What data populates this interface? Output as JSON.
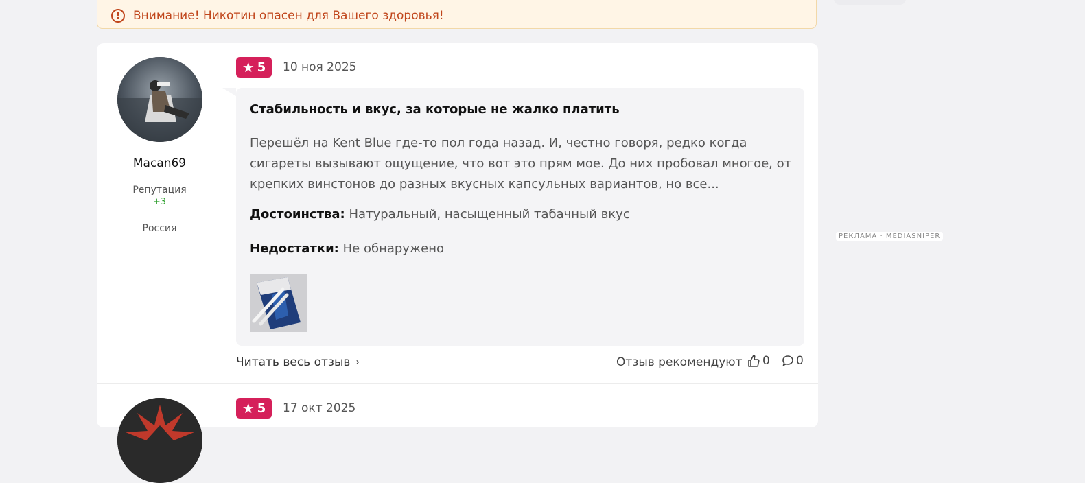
{
  "warning": {
    "text": "Внимание! Никотин опасен для Вашего здоровья!",
    "icon": "alert-circle-icon"
  },
  "ad": {
    "label": "РЕКЛАМА · MEDIASNIPER"
  },
  "reviews": [
    {
      "author": "Macan69",
      "reputation_label": "Репутация",
      "reputation_value": "+3",
      "country": "Россия",
      "rating": "5",
      "date": "10 ноя 2025",
      "title": "Стабильность и вкус, за которые не жалко платить",
      "text": "Перешёл на Kent Blue где-то пол года назад. И, честно говоря, редко когда сигареты вызывают ощущение, что вот это прям мое. До них пробовал многое, от крепких винстонов до разных вкусных капсульных вариантов, но все...",
      "pros_label": "Достоинства:",
      "pros": "Натуральный, насыщенный табачный вкус",
      "cons_label": "Недостатки:",
      "cons": "Не обнаружено",
      "read_more": "Читать весь отзыв",
      "recommend_label": "Отзыв рекомендуют",
      "likes": "0",
      "comments": "0"
    },
    {
      "rating": "5",
      "date": "17 окт 2025"
    }
  ],
  "colors": {
    "accent": "#d5205a",
    "warning": "#c0451b",
    "reputation": "#2a9d2a"
  }
}
